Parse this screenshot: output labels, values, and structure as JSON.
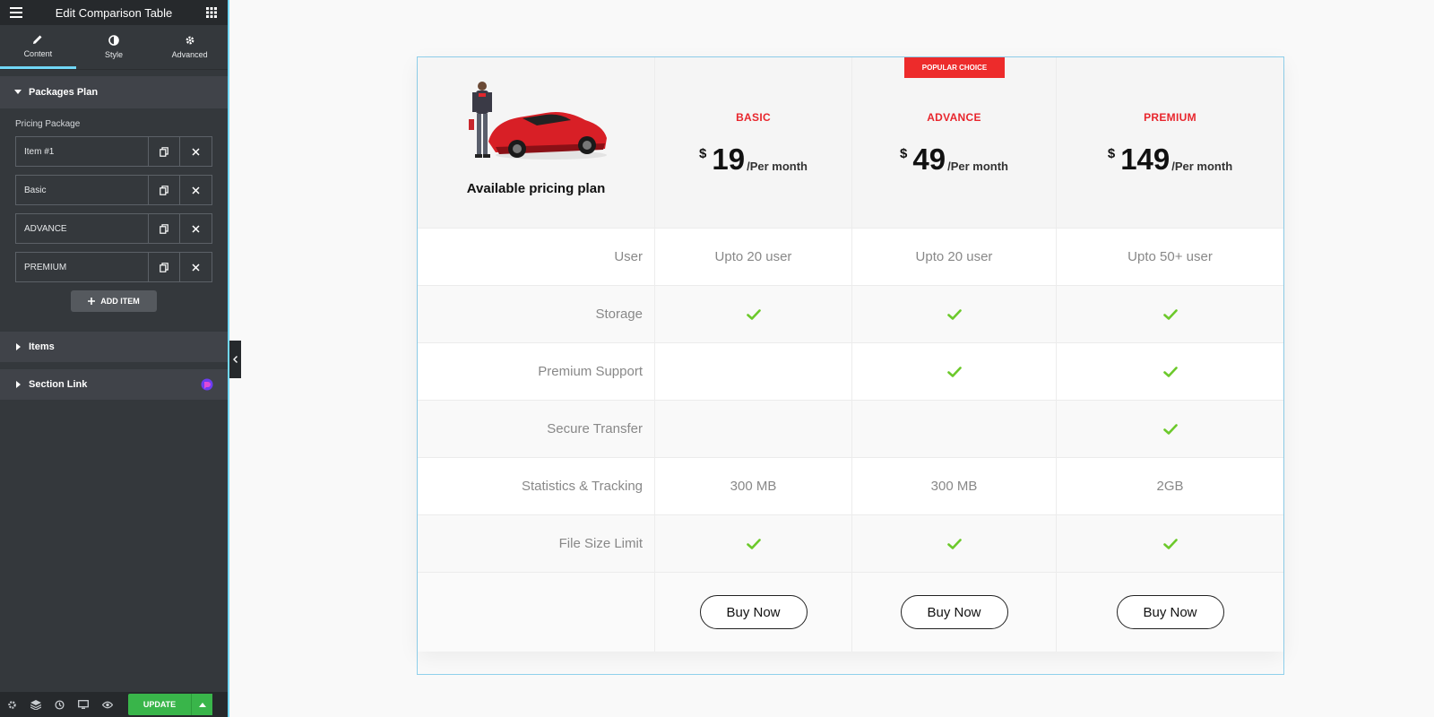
{
  "sidebar": {
    "title": "Edit Comparison Table",
    "tabs": [
      {
        "label": "Content"
      },
      {
        "label": "Style"
      },
      {
        "label": "Advanced"
      }
    ],
    "packages_section": "Packages Plan",
    "pricing_package_label": "Pricing Package",
    "items": [
      {
        "label": "Item #1"
      },
      {
        "label": "Basic"
      },
      {
        "label": "ADVANCE"
      },
      {
        "label": "PREMIUM"
      }
    ],
    "add_item_label": "ADD ITEM",
    "items_section": "Items",
    "section_link": "Section Link",
    "update_label": "UPDATE",
    "accent_color": "#71d7f7",
    "update_color": "#39b54a"
  },
  "table": {
    "heading": "Available pricing plan",
    "badge": "POPULAR CHOICE",
    "plans": [
      {
        "name": "BASIC",
        "currency": "$",
        "amount": "19",
        "period": "/Per month"
      },
      {
        "name": "ADVANCE",
        "currency": "$",
        "amount": "49",
        "period": "/Per month"
      },
      {
        "name": "PREMIUM",
        "currency": "$",
        "amount": "149",
        "period": "/Per month"
      }
    ],
    "features": [
      {
        "label": "User",
        "values": [
          "Upto 20 user",
          "Upto 20 user",
          "Upto 50+ user"
        ]
      },
      {
        "label": "Storage",
        "values": [
          "check",
          "check",
          "check"
        ]
      },
      {
        "label": "Premium Support",
        "values": [
          "",
          "check",
          "check"
        ]
      },
      {
        "label": "Secure Transfer",
        "values": [
          "",
          "",
          "check"
        ]
      },
      {
        "label": "Statistics & Tracking",
        "values": [
          "300 MB",
          "300 MB",
          "2GB"
        ]
      },
      {
        "label": "File Size Limit",
        "values": [
          "check",
          "check",
          "check"
        ]
      }
    ],
    "button_label": "Buy Now",
    "accent_color": "#e8262d",
    "check_color": "#6cc92b"
  }
}
